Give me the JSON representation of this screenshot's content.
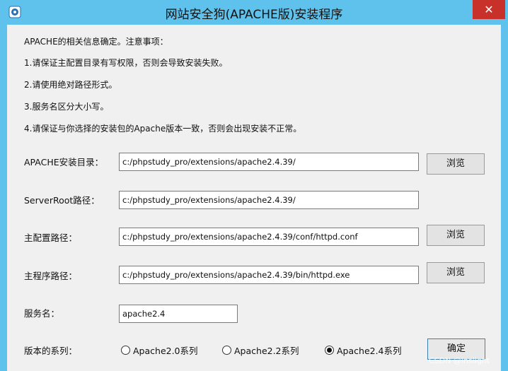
{
  "window": {
    "title": "网站安全狗(APACHE版)安装程序",
    "close_label": "✕"
  },
  "notes": [
    "APACHE的相关信息确定。注意事项：",
    "1.请保证主配置目录有写权限，否则会导致安装失败。",
    "2.请使用绝对路径形式。",
    "3.服务名区分大小写。",
    "4.请保证与你选择的安装包的Apache版本一致，否则会出现安装不正常。"
  ],
  "form": {
    "apache_dir": {
      "label": "APACHE安装目录：",
      "value": "c:/phpstudy_pro/extensions/apache2.4.39/",
      "browse_label": "浏览"
    },
    "server_root": {
      "label": "ServerRoot路径：",
      "value": "c:/phpstudy_pro/extensions/apache2.4.39/"
    },
    "config_path": {
      "label": "主配置路径：",
      "value": "c:/phpstudy_pro/extensions/apache2.4.39/conf/httpd.conf",
      "browse_label": "浏览"
    },
    "exe_path": {
      "label": "主程序路径：",
      "value": "c:/phpstudy_pro/extensions/apache2.4.39/bin/httpd.exe",
      "browse_label": "浏览"
    },
    "service_name": {
      "label": "服务名：",
      "value": "apache2.4"
    },
    "version_series": {
      "label": "版本的系列：",
      "options": [
        {
          "label": "Apache2.0系列",
          "selected": false
        },
        {
          "label": "Apache2.2系列",
          "selected": false
        },
        {
          "label": "Apache2.4系列",
          "selected": true
        }
      ]
    }
  },
  "confirm_label": "确定",
  "watermark": "CSDN @inslight",
  "colors": {
    "titlebar": "#5ec2ec",
    "close": "#c8302a",
    "client": "#f0f0f0"
  }
}
